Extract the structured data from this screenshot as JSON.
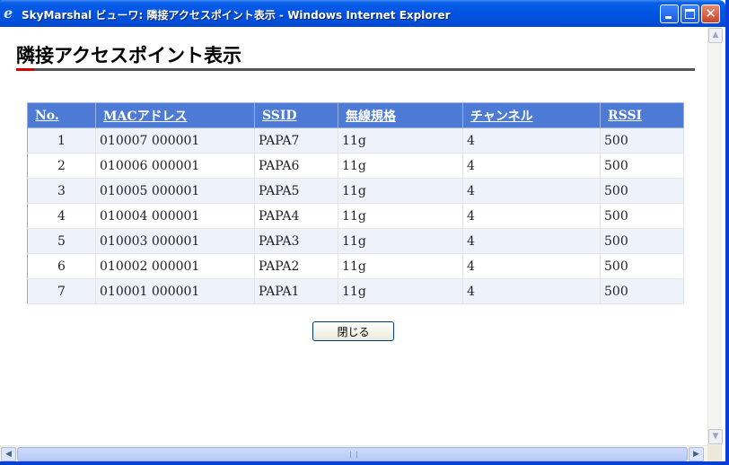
{
  "window": {
    "title": "SkyMarshal ビューワ: 隣接アクセスポイント表示 - Windows Internet Explorer",
    "icon": "internet-explorer-icon"
  },
  "page": {
    "heading": "隣接アクセスポイント表示",
    "accent_color": "#d40000"
  },
  "table": {
    "columns": [
      "No.",
      "MACアドレス",
      "SSID",
      "無線規格",
      "チャンネル",
      "RSSI"
    ],
    "rows": [
      [
        "1",
        "010007 000001",
        "PAPA7",
        "11g",
        "4",
        "500"
      ],
      [
        "2",
        "010006 000001",
        "PAPA6",
        "11g",
        "4",
        "500"
      ],
      [
        "3",
        "010005 000001",
        "PAPA5",
        "11g",
        "4",
        "500"
      ],
      [
        "4",
        "010004 000001",
        "PAPA4",
        "11g",
        "4",
        "500"
      ],
      [
        "5",
        "010003 000001",
        "PAPA3",
        "11g",
        "4",
        "500"
      ],
      [
        "6",
        "010002 000001",
        "PAPA2",
        "11g",
        "4",
        "500"
      ],
      [
        "7",
        "010001 000001",
        "PAPA1",
        "11g",
        "4",
        "500"
      ]
    ],
    "header_color": "#4d7ad4"
  },
  "actions": {
    "close_label": "閉じる"
  }
}
